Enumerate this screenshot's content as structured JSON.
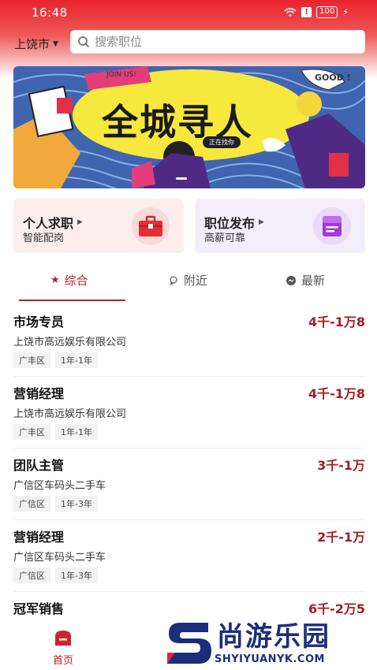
{
  "status_bar": {
    "time": "16:48",
    "battery": "100"
  },
  "header": {
    "city": "上饶市",
    "search_placeholder": "搜索职位"
  },
  "banner": {
    "title": "全城寻人",
    "badge": "正在找你",
    "join_text": "JOIN US!",
    "bubble_text": "GOOD !"
  },
  "cards": [
    {
      "title": "个人求职",
      "subtitle": "智能配岗",
      "icon": "briefcase-icon"
    },
    {
      "title": "职位发布",
      "subtitle": "高薪可靠",
      "icon": "document-icon"
    }
  ],
  "tabs": [
    {
      "label": "综合",
      "icon": "star-icon",
      "active": true
    },
    {
      "label": "附近",
      "icon": "location-icon",
      "active": false
    },
    {
      "label": "最新",
      "icon": "chat-icon",
      "active": false
    }
  ],
  "jobs": [
    {
      "title": "市场专员",
      "salary": "4千-1万8",
      "company": "上饶市高远娱乐有限公司",
      "tags": [
        "广丰区",
        "1年-1年"
      ]
    },
    {
      "title": "营销经理",
      "salary": "4千-1万8",
      "company": "上饶市高远娱乐有限公司",
      "tags": [
        "广丰区",
        "1年-1年"
      ]
    },
    {
      "title": "团队主管",
      "salary": "3千-1万",
      "company": "广信区车码头二手车",
      "tags": [
        "广信区",
        "1年-3年"
      ]
    },
    {
      "title": "营销经理",
      "salary": "2千-1万",
      "company": "广信区车码头二手车",
      "tags": [
        "广信区",
        "1年-3年"
      ]
    },
    {
      "title": "冠军销售",
      "salary": "6千-2万5",
      "company": "",
      "tags": []
    }
  ],
  "bottom_nav": {
    "home_label": "首页"
  },
  "watermark": {
    "text": "尚游乐园",
    "url": "SHYIYUANYK.COM"
  },
  "colors": {
    "accent": "#b32027",
    "header_red": "#e8232f"
  }
}
